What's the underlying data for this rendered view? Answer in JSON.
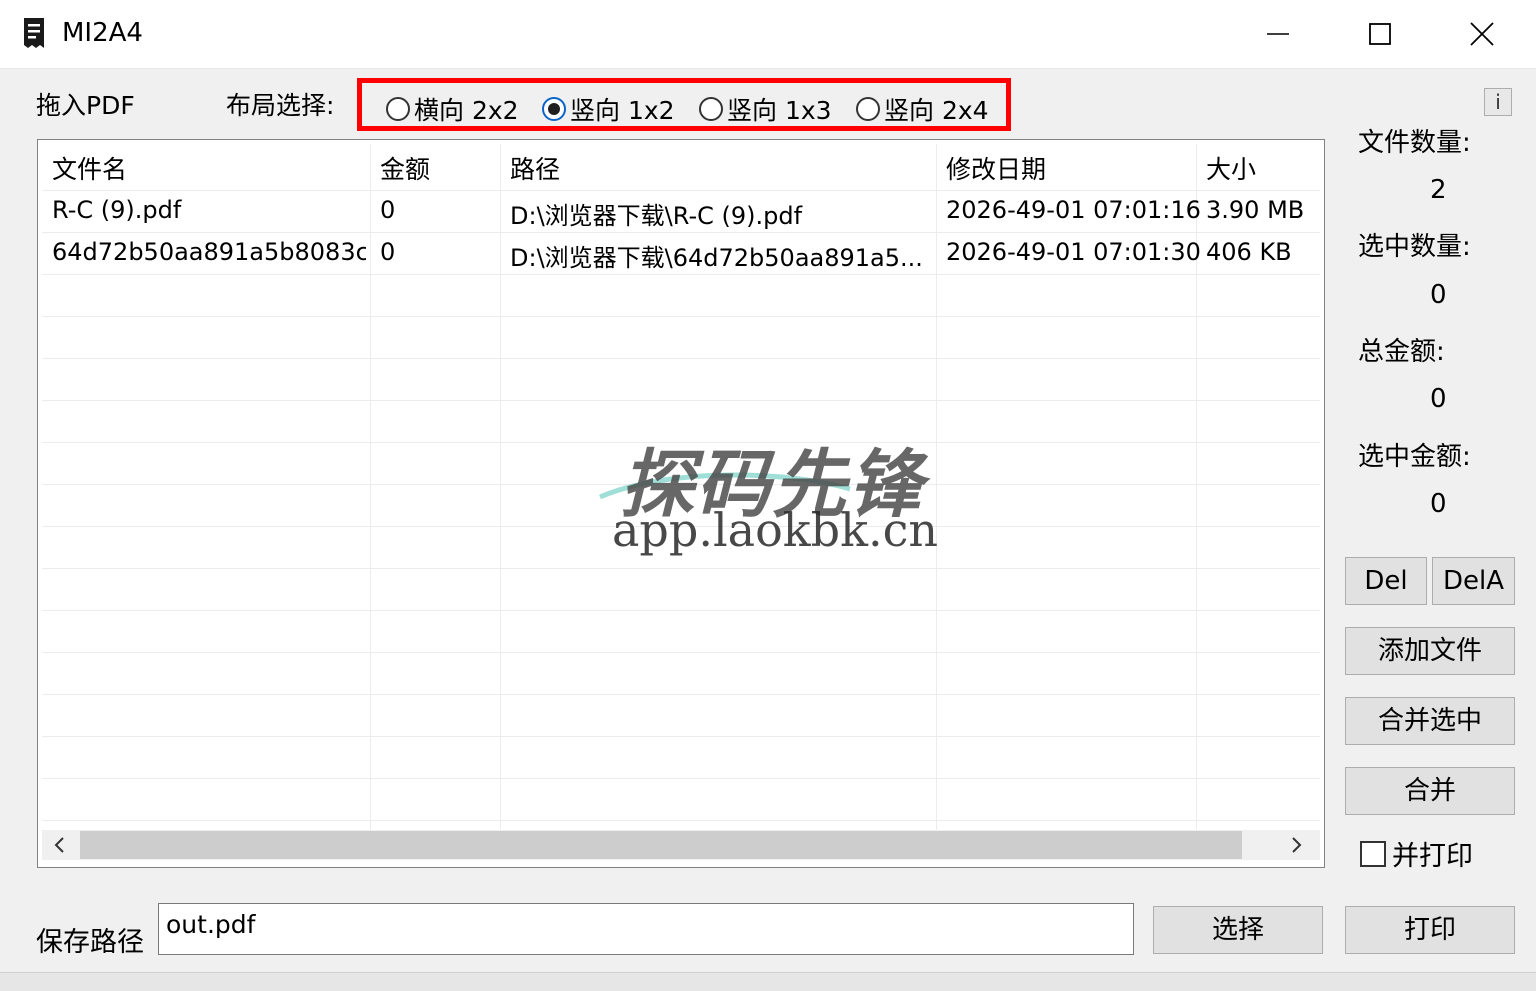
{
  "window": {
    "title": "MI2A4"
  },
  "toolbar": {
    "drag_label": "拖入PDF",
    "layout_label": "布局选择:",
    "layout_options": [
      {
        "label": "横向 2x2",
        "checked": false
      },
      {
        "label": "竖向 1x2",
        "checked": true
      },
      {
        "label": "竖向 1x3",
        "checked": false
      },
      {
        "label": "竖向 2x4",
        "checked": false
      }
    ],
    "info_button": "i"
  },
  "table": {
    "columns": [
      "文件名",
      "金额",
      "路径",
      "修改日期",
      "大小"
    ],
    "rows": [
      [
        "R-C (9).pdf",
        "0",
        "D:\\浏览器下载\\R-C (9).pdf",
        "2026-49-01 07:01:16",
        "3.90 MB"
      ],
      [
        "64d72b50aa891a5b8083c...",
        "0",
        "D:\\浏览器下载\\64d72b50aa891a5...",
        "2026-49-01 07:01:30",
        "406 KB"
      ]
    ]
  },
  "watermark": {
    "title": "探码先锋",
    "url": "app.laokbk.cn"
  },
  "stats": {
    "file_count_label": "文件数量:",
    "file_count": "2",
    "selected_count_label": "选中数量:",
    "selected_count": "0",
    "total_amount_label": "总金额:",
    "total_amount": "0",
    "selected_amount_label": "选中金额:",
    "selected_amount": "0"
  },
  "buttons": {
    "del": "Del",
    "dela": "DelA",
    "add_file": "添加文件",
    "merge_selected": "合并选中",
    "merge": "合并",
    "choose": "选择",
    "print": "打印"
  },
  "merge_print": {
    "label": "并打印",
    "checked": false
  },
  "save": {
    "label": "保存路径",
    "value": "out.pdf"
  },
  "colors": {
    "highlight_border": "#ff0000",
    "radio_accent": "#0a64c8"
  }
}
